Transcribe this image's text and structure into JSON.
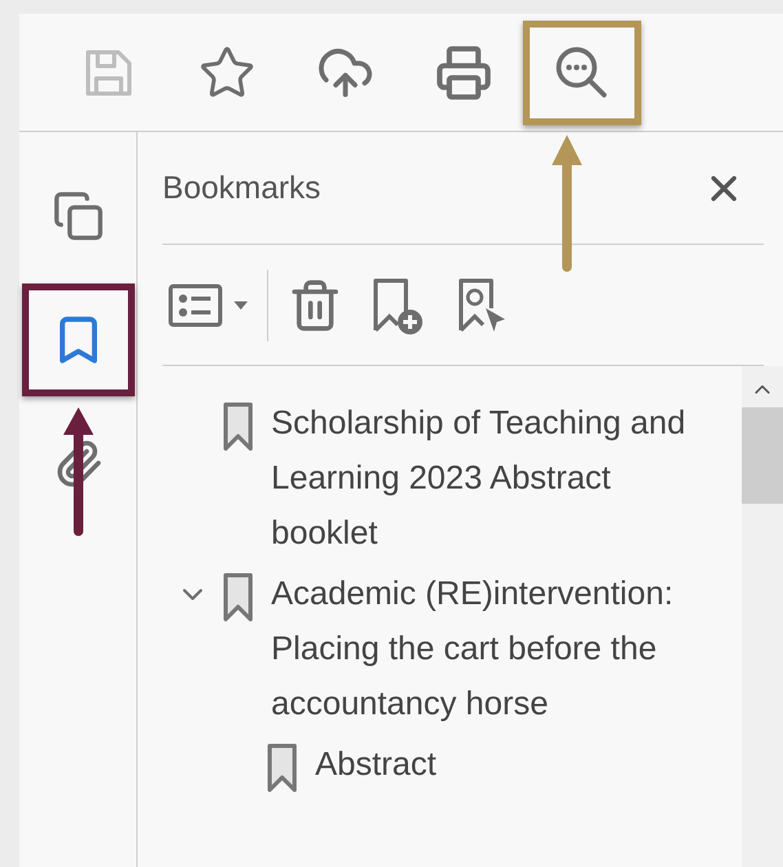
{
  "toolbar": {
    "tools": [
      {
        "kind": "save",
        "disabled": true,
        "highlighted": false
      },
      {
        "kind": "star",
        "disabled": false,
        "highlighted": false
      },
      {
        "kind": "upload",
        "disabled": false,
        "highlighted": false
      },
      {
        "kind": "print",
        "disabled": false,
        "highlighted": false
      },
      {
        "kind": "search",
        "disabled": false,
        "highlighted": true
      }
    ]
  },
  "sidebar": {
    "tabs": [
      {
        "kind": "pages",
        "selected": false,
        "highlighted": false
      },
      {
        "kind": "bookmarks",
        "selected": true,
        "highlighted": true
      },
      {
        "kind": "attachments",
        "selected": false,
        "highlighted": false
      }
    ]
  },
  "panel": {
    "title": "Bookmarks",
    "tools": [
      {
        "kind": "options"
      },
      {
        "kind": "delete"
      },
      {
        "kind": "add"
      },
      {
        "kind": "find"
      }
    ],
    "bookmarks": [
      {
        "label": "Scholarship of Teaching and Learning 2023 Abstract booklet"
      },
      {
        "label": "Academic (RE)intervention: Placing the cart before the accountancy horse",
        "expanded": true,
        "children": [
          {
            "label": "Abstract"
          }
        ]
      }
    ]
  }
}
